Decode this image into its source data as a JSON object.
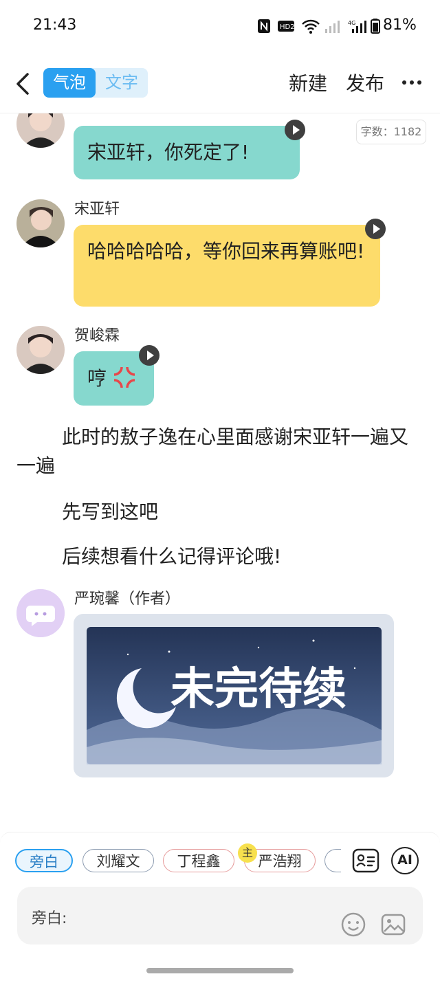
{
  "status": {
    "time": "21:43",
    "battery": "81%",
    "icons": [
      "nfc-icon",
      "hd-icon",
      "wifi-icon",
      "signal-icon",
      "4g-signal-icon",
      "battery-icon"
    ]
  },
  "header": {
    "tabs": [
      {
        "label": "气泡",
        "active": true
      },
      {
        "label": "文字",
        "active": false
      }
    ],
    "new_label": "新建",
    "publish_label": "发布"
  },
  "word_count": "字数：1182",
  "messages": [
    {
      "name": "",
      "text": "宋亚轩，你死定了!",
      "color": "#86d8ce"
    },
    {
      "name": "宋亚轩",
      "text": "哈哈哈哈哈，等你回来再算账吧!",
      "color": "#fddc6b"
    },
    {
      "name": "贺峻霖",
      "text": "哼",
      "color": "#86d8ce"
    }
  ],
  "narration": [
    "此时的敖子逸在心里面感谢宋亚轩一遍又一遍",
    "先写到这吧",
    "后续想看什么记得评论哦!"
  ],
  "author": {
    "name": "严琬馨（作者）",
    "image_text": "未完待续"
  },
  "characters": [
    {
      "label": "旁白",
      "selected": true
    },
    {
      "label": "刘耀文",
      "selected": false
    },
    {
      "label": "丁程鑫",
      "selected": false
    },
    {
      "label": "严浩翔",
      "selected": false,
      "badge": "主"
    }
  ],
  "ai_label": "AI",
  "input": {
    "label": "旁白:"
  },
  "colors": {
    "accent": "#2aa0f0",
    "teal": "#86d8ce",
    "yellow": "#fddc6b"
  }
}
